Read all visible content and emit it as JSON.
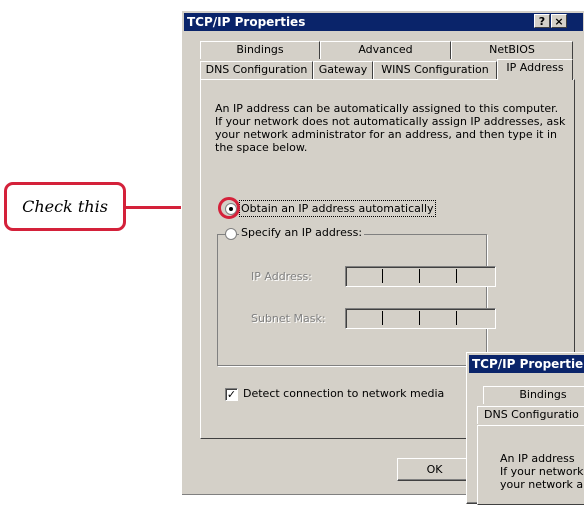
{
  "window": {
    "title": "TCP/IP Properties",
    "help_label": "?",
    "close_label": "×",
    "tabs_row1": [
      "Bindings",
      "Advanced",
      "NetBIOS"
    ],
    "tabs_row2": [
      "DNS Configuration",
      "Gateway",
      "WINS Configuration",
      "IP Address"
    ],
    "description": [
      "An IP address can be automatically assigned to this computer.",
      "If your network does not automatically assign IP addresses, ask",
      "your network administrator for an address, and then type it in",
      "the space below."
    ],
    "obtain_label": "Obtain an IP address automatically",
    "specify_label": "Specify an IP address:",
    "ip_address_label": "IP Address:",
    "subnet_mask_label": "Subnet Mask:",
    "detect_label": "Detect connection to network media",
    "detect_checked": true,
    "obtain_selected": true,
    "ok_label": "OK"
  },
  "window2": {
    "title": "TCP/IP Propertie",
    "tab_bindings": "Bindings",
    "tab_dns": "DNS Configuratio",
    "desc_lines": [
      "An IP address",
      "If your network",
      "your network a"
    ]
  },
  "callout": {
    "text": "Check this",
    "color": "#d4213a"
  },
  "colors": {
    "titlebar": "#0a246a",
    "face": "#d4d0c8"
  }
}
